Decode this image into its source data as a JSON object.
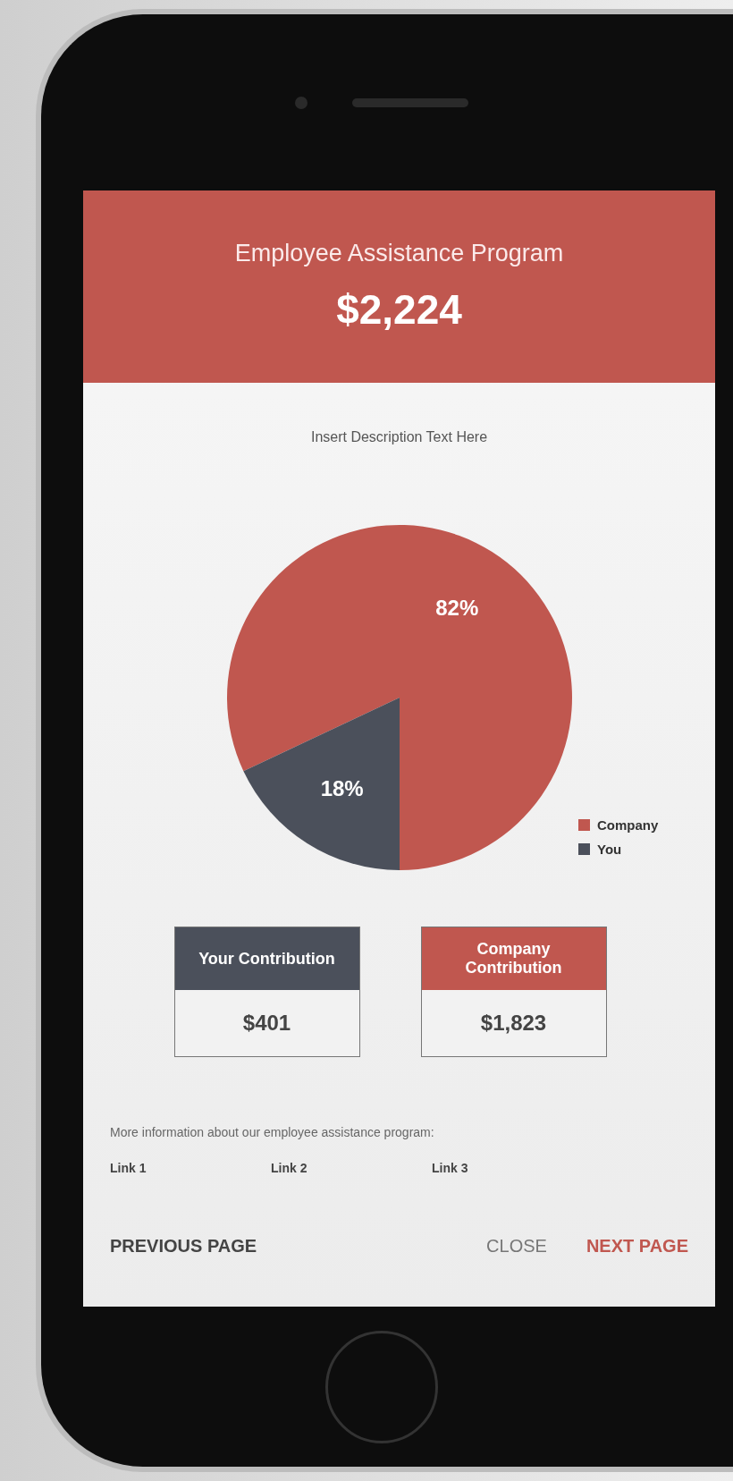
{
  "header": {
    "title": "Employee Assistance Program",
    "amount": "$2,224"
  },
  "description": "Insert Description Text Here",
  "chart": {
    "chart_data": {
      "type": "pie",
      "categories": [
        "Company",
        "You"
      ],
      "values": [
        82,
        18
      ],
      "value_labels": [
        "82%",
        "18%"
      ]
    },
    "legend": [
      {
        "color": "#c0574f"
      },
      {
        "color": "#4b505b"
      }
    ]
  },
  "contributions": [
    {
      "title": "Your Contribution",
      "value": "$401",
      "color": "#4b505b"
    },
    {
      "title": "Company Contribution",
      "value": "$1,823",
      "color": "#c0574f"
    }
  ],
  "info_text": "More information about our employee assistance program:",
  "links": [
    "Link 1",
    "Link 2",
    "Link 3"
  ],
  "footer": {
    "previous": "PREVIOUS PAGE",
    "close": "CLOSE",
    "next": "NEXT PAGE"
  }
}
